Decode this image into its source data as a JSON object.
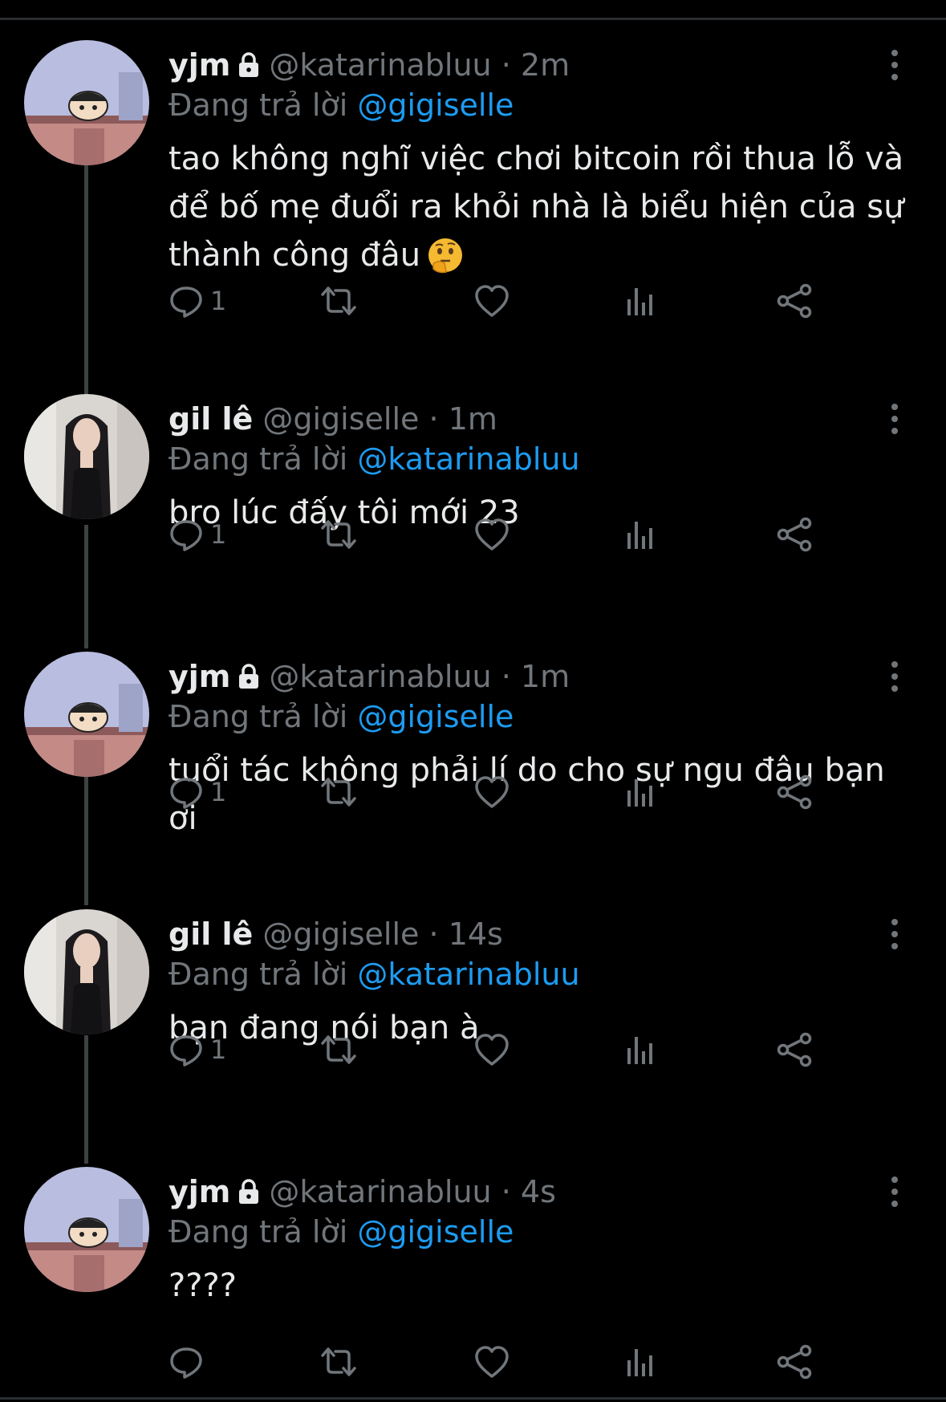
{
  "replying_prefix": "Đang trả lời",
  "colors": {
    "background": "#000000",
    "text": "#e7e9ea",
    "secondary": "#71767b",
    "mention": "#1d9bf0",
    "thread_line": "#3e4144"
  },
  "tweets": [
    {
      "name": "yjm",
      "locked": true,
      "handle": "@katarinabluu",
      "sep": "·",
      "time": "2m",
      "replying_to": "@gigiselle",
      "text": "tao không nghĩ việc chơi bitcoin rồi thua lỗ và để bố mẹ đuổi ra khỏi nhà là biểu hiện của sự thành công đâu",
      "emoji": "thinking-face-emoji",
      "reply_count": "1",
      "avatar": "cartoon-avatar"
    },
    {
      "name": "gil lê",
      "locked": false,
      "handle": "@gigiselle",
      "sep": "·",
      "time": "1m",
      "replying_to": "@katarinabluu",
      "text": "bro lúc đấy tôi mới 23",
      "reply_count": "1",
      "avatar": "photo-avatar"
    },
    {
      "name": "yjm",
      "locked": true,
      "handle": "@katarinabluu",
      "sep": "·",
      "time": "1m",
      "replying_to": "@gigiselle",
      "text": "tuổi tác không phải lí do cho sự ngu đâu bạn ơi",
      "reply_count": "1",
      "avatar": "cartoon-avatar"
    },
    {
      "name": "gil lê",
      "locked": false,
      "handle": "@gigiselle",
      "sep": "·",
      "time": "14s",
      "replying_to": "@katarinabluu",
      "text": "bạn đang nói bạn à",
      "reply_count": "1",
      "avatar": "photo-avatar"
    },
    {
      "name": "yjm",
      "locked": true,
      "handle": "@katarinabluu",
      "sep": "·",
      "time": "4s",
      "replying_to": "@gigiselle",
      "text": "????",
      "reply_count": "",
      "avatar": "cartoon-avatar"
    }
  ]
}
